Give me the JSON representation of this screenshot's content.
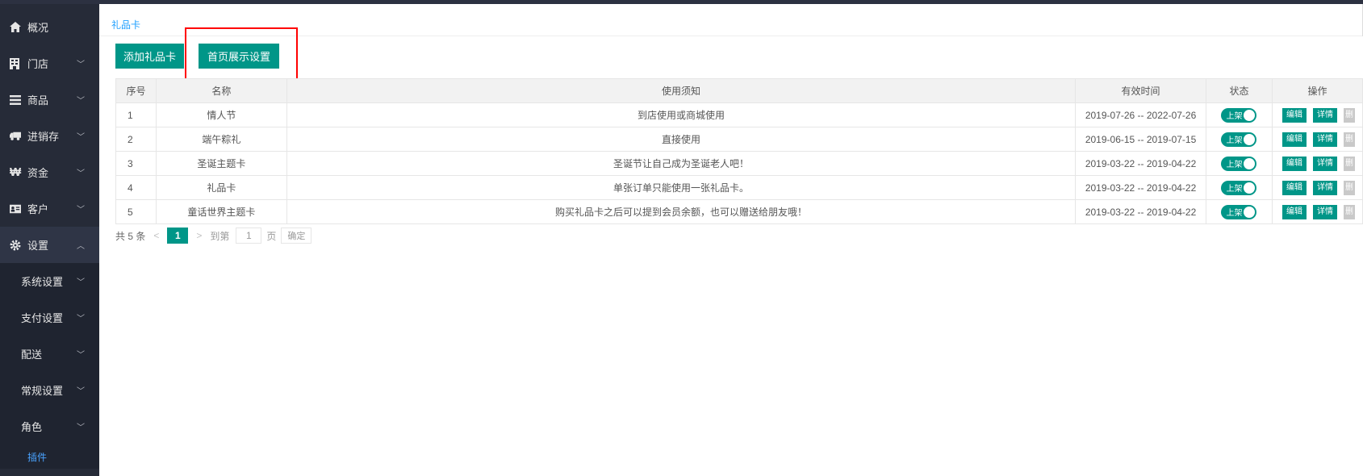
{
  "sidebar": {
    "items": [
      {
        "label": "概况",
        "icon": "home-icon"
      },
      {
        "label": "门店",
        "icon": "building-icon"
      },
      {
        "label": "商品",
        "icon": "list-icon"
      },
      {
        "label": "进销存",
        "icon": "truck-icon"
      },
      {
        "label": "资金",
        "icon": "won-icon"
      },
      {
        "label": "客户",
        "icon": "id-card-icon"
      },
      {
        "label": "设置",
        "icon": "gear-icon"
      }
    ],
    "sub_items": [
      {
        "label": "系统设置"
      },
      {
        "label": "支付设置"
      },
      {
        "label": "配送"
      },
      {
        "label": "常规设置"
      },
      {
        "label": "角色"
      }
    ],
    "plugin_label": "插件"
  },
  "breadcrumb": "礼品卡",
  "toolbar": {
    "add_label": "添加礼品卡",
    "homepage_label": "首页展示设置"
  },
  "table": {
    "headers": [
      "序号",
      "名称",
      "使用须知",
      "有效时间",
      "状态",
      "操作"
    ],
    "rows": [
      {
        "no": "1",
        "name": "情人节",
        "notice": "到店使用或商城使用",
        "valid": "2019-07-26 -- 2022-07-26",
        "status": "上架"
      },
      {
        "no": "2",
        "name": "端午粽礼",
        "notice": "直接使用",
        "valid": "2019-06-15 -- 2019-07-15",
        "status": "上架"
      },
      {
        "no": "3",
        "name": "圣诞主题卡",
        "notice": "圣诞节让自己成为圣诞老人吧！",
        "valid": "2019-03-22 -- 2019-04-22",
        "status": "上架"
      },
      {
        "no": "4",
        "name": "礼品卡",
        "notice": "单张订单只能使用一张礼品卡。",
        "valid": "2019-03-22 -- 2019-04-22",
        "status": "上架"
      },
      {
        "no": "5",
        "name": "童话世界主题卡",
        "notice": "购买礼品卡之后可以提到会员余额，也可以赠送给朋友哦！",
        "valid": "2019-03-22 -- 2019-04-22",
        "status": "上架"
      }
    ],
    "op_edit": "编辑",
    "op_detail": "详情",
    "op_delete": "删"
  },
  "pager": {
    "total": "共 5 条",
    "current": "1",
    "goto_label": "到第",
    "goto_value": "1",
    "page_label": "页",
    "confirm_label": "确定"
  },
  "colors": {
    "accent": "#009688",
    "sidebar_bg": "#262b38",
    "link": "#1e9fff",
    "highlight": "#ff0000"
  }
}
